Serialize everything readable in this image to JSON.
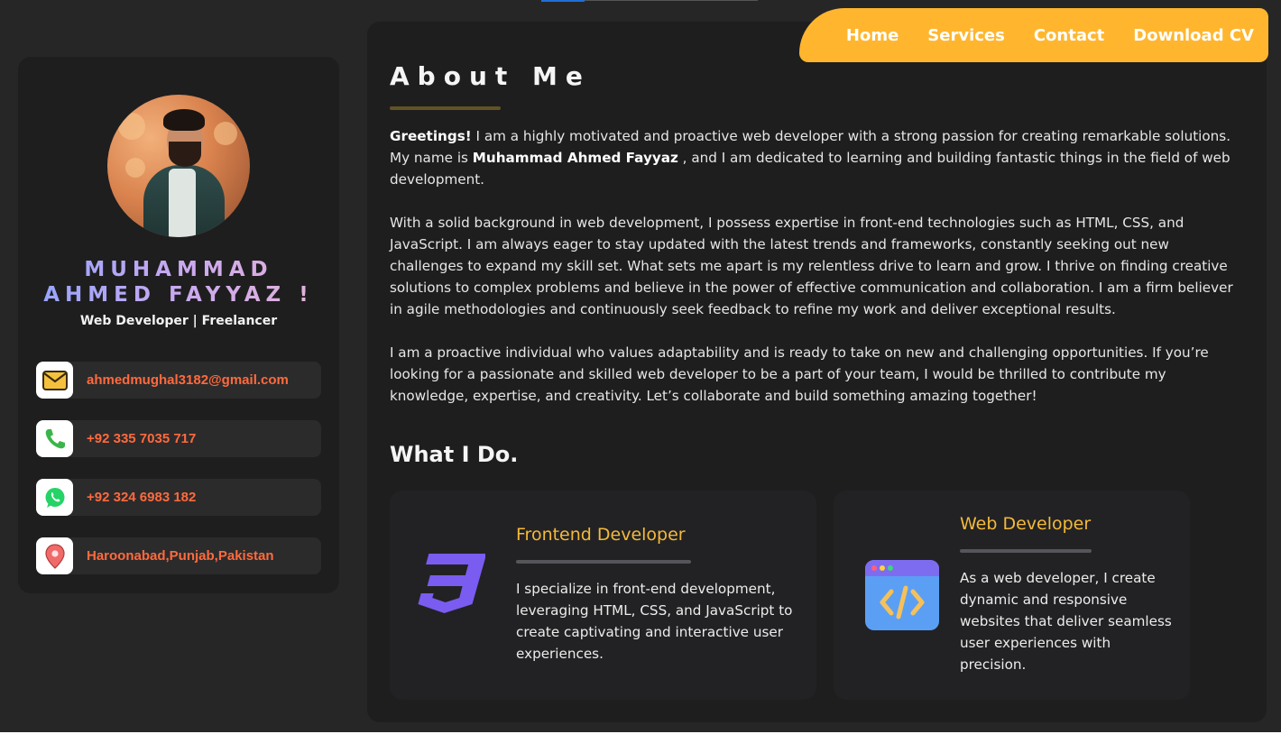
{
  "nav": {
    "items": [
      "Home",
      "Services",
      "Contact",
      "Download CV"
    ]
  },
  "sidebar": {
    "name_line1": "MUHAMMAD",
    "name_line2": "AHMED FAYYAZ !",
    "role": "Web Developer | Freelancer",
    "contacts": [
      {
        "icon": "envelope-icon",
        "text": "ahmedmughal3182@gmail.com"
      },
      {
        "icon": "phone-icon",
        "text": "+92 335 7035 717"
      },
      {
        "icon": "whatsapp-icon",
        "text": "+92 324 6983 182"
      },
      {
        "icon": "location-pin-icon",
        "text": "Haroonabad,Punjab,Pakistan"
      }
    ]
  },
  "about": {
    "title": "About Me",
    "p1_greeting": "Greetings!",
    "p1_a": " I am a highly motivated and proactive web developer with a strong passion for creating remarkable solutions. My name is ",
    "p1_name": "Muhammad Ahmed Fayyaz",
    "p1_b": " , and I am dedicated to learning and building fantastic things in the field of web development.",
    "p2": "With a solid background in web development, I possess expertise in front-end technologies such as HTML, CSS, and JavaScript. I am always eager to stay updated with the latest trends and frameworks, constantly seeking out new challenges to expand my skill set. What sets me apart is my relentless drive to learn and grow. I thrive on finding creative solutions to complex problems and believe in the power of effective communication and collaboration. I am a firm believer in agile methodologies and continuously seek feedback to refine my work and deliver exceptional results.",
    "p3": "I am a proactive individual who values adaptability and is ready to take on new and challenging opportunities. If you’re looking for a passionate and skilled web developer to be a part of your team, I would be thrilled to contribute my knowledge, expertise, and creativity. Let’s collaborate and build something amazing together!"
  },
  "what_i_do": {
    "title": "What I Do.",
    "cards": [
      {
        "icon": "css3-icon",
        "title": "Frontend Developer",
        "text": "I specialize in front-end development, leveraging HTML, CSS, and JavaScript to create captivating and interactive user experiences."
      },
      {
        "icon": "code-window-icon",
        "title": "Web Developer",
        "text": "As a web developer, I create dynamic and responsive websites that deliver seamless user experiences with precision."
      }
    ]
  },
  "colors": {
    "accent": "#ffb62e",
    "card_title": "#f4b93a",
    "contact_text": "#ff6a3d",
    "background": "#262626",
    "panel": "#1e1e1f"
  }
}
